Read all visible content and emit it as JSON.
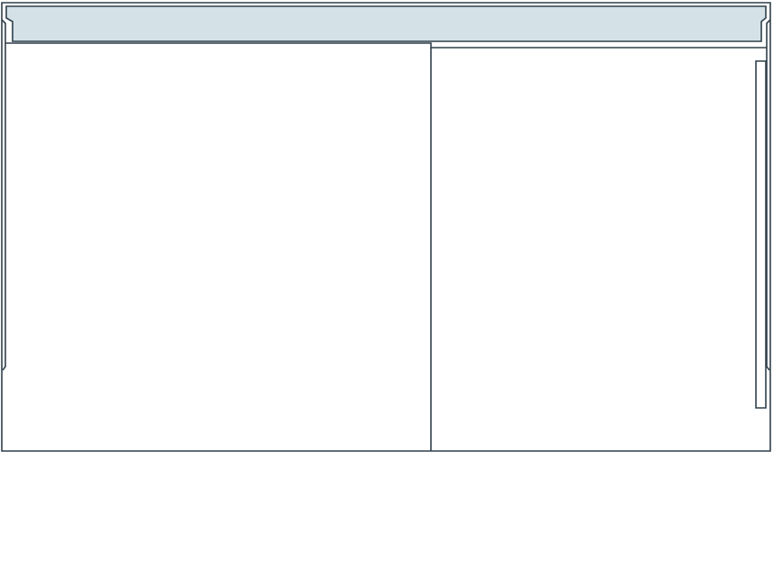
{
  "drawing": {
    "style": "technical outline drawing",
    "line_color": "#2e3f4a",
    "background_color": "#ffffff",
    "header_fill_color": "#d4e2e8",
    "text_labels": []
  }
}
